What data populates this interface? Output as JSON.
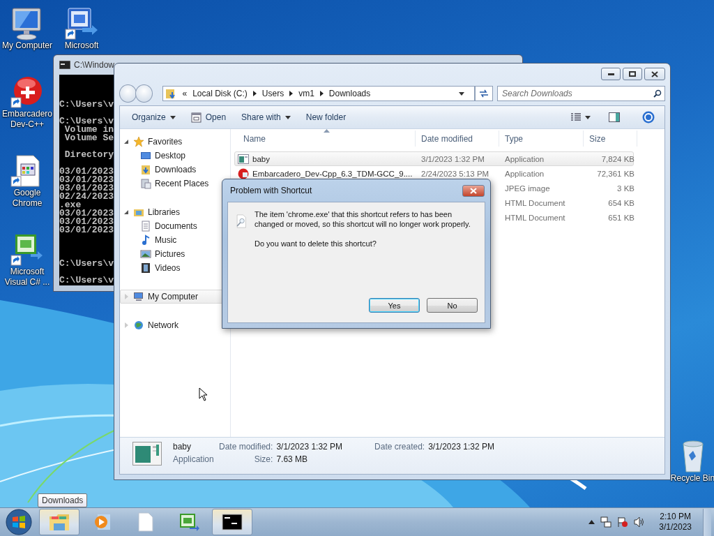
{
  "desktop": {
    "left_column": [
      {
        "label": "My Computer",
        "kind": "computer"
      },
      {
        "label": "Embarcadero Dev-C++",
        "kind": "devcpp"
      },
      {
        "label": "Google Chrome",
        "kind": "document"
      },
      {
        "label": "Microsoft Visual C# ...",
        "kind": "csharp"
      }
    ],
    "second_column": [
      {
        "label": "Microsoft",
        "kind": "vb"
      }
    ],
    "right_column": [
      {
        "label": "Recycle Bin",
        "kind": "recycle"
      }
    ]
  },
  "console_window": {
    "title": "C:\\Window",
    "lines": [
      {
        "kind": "blank"
      },
      {
        "kind": "blank"
      },
      {
        "kind": "blank"
      },
      {
        "kind": "text",
        "text": "C:\\Users\\v"
      },
      {
        "kind": "blank"
      },
      {
        "kind": "text",
        "text": "C:\\Users\\v"
      },
      {
        "kind": "text",
        "text": " Volume in"
      },
      {
        "kind": "text",
        "text": " Volume Se"
      },
      {
        "kind": "blank"
      },
      {
        "kind": "text",
        "text": " Directory"
      },
      {
        "kind": "blank"
      },
      {
        "kind": "text",
        "text": "03/01/2023"
      },
      {
        "kind": "text",
        "text": "03/01/2023"
      },
      {
        "kind": "text",
        "text": "03/01/2023"
      },
      {
        "kind": "text",
        "text": "02/24/2023"
      },
      {
        "kind": "text",
        "text": ".exe"
      },
      {
        "kind": "text",
        "text": "03/01/2023"
      },
      {
        "kind": "text",
        "text": "03/01/2023"
      },
      {
        "kind": "text",
        "text": "03/01/2023"
      },
      {
        "kind": "blank"
      },
      {
        "kind": "blank"
      },
      {
        "kind": "blank"
      },
      {
        "kind": "text",
        "text": "C:\\Users\\v"
      },
      {
        "kind": "blank"
      },
      {
        "kind": "text",
        "text": "C:\\Users\\v"
      }
    ]
  },
  "explorer": {
    "address": {
      "overflow_mark": "«",
      "path": [
        "Local Disk (C:)",
        "Users",
        "vm1",
        "Downloads"
      ]
    },
    "search": {
      "placeholder": "Search Downloads"
    },
    "toolbar": [
      {
        "label": "Organize",
        "kind": "menu"
      },
      {
        "label": "Open",
        "kind": "icon_command"
      },
      {
        "label": "Share with",
        "kind": "menu"
      },
      {
        "label": "New folder",
        "kind": "command"
      }
    ],
    "nav": [
      {
        "label": "Favorites",
        "kind": "favorites",
        "expanded": true,
        "selected": false,
        "children": [
          {
            "label": "Desktop",
            "kind": "desktop",
            "selected": false
          },
          {
            "label": "Downloads",
            "kind": "downloads",
            "selected": false
          },
          {
            "label": "Recent Places",
            "kind": "recent",
            "selected": false
          }
        ]
      },
      {
        "label": "Libraries",
        "kind": "libraries",
        "expanded": true,
        "selected": false,
        "children": [
          {
            "label": "Documents",
            "kind": "documents",
            "selected": false
          },
          {
            "label": "Music",
            "kind": "music",
            "selected": false
          },
          {
            "label": "Pictures",
            "kind": "pictures",
            "selected": false
          },
          {
            "label": "Videos",
            "kind": "videos",
            "selected": false
          }
        ]
      },
      {
        "label": "My Computer",
        "kind": "computer",
        "expanded": false,
        "selected": true
      },
      {
        "label": "Network",
        "kind": "network",
        "expanded": false,
        "selected": false
      }
    ],
    "columns": [
      {
        "label": "Name",
        "sorted": true
      },
      {
        "label": "Date modified",
        "sorted": false
      },
      {
        "label": "Type",
        "sorted": false
      },
      {
        "label": "Size",
        "sorted": false
      }
    ],
    "rows": [
      {
        "name": "baby",
        "date": "3/1/2023 1:32 PM",
        "type": "Application",
        "size": "7,824 KB",
        "kind": "app",
        "selected": true
      },
      {
        "name": "Embarcadero_Dev-Cpp_6.3_TDM-GCC_9....",
        "date": "2/24/2023 5:13 PM",
        "type": "Application",
        "size": "72,361 KB",
        "kind": "devcpp",
        "selected": false
      },
      {
        "type": "JPEG image",
        "size": "3 KB",
        "selected": false
      },
      {
        "type": "HTML Document",
        "size": "654 KB",
        "selected": false
      },
      {
        "type": "HTML Document",
        "size": "651 KB",
        "selected": false
      }
    ],
    "details": {
      "name": "baby",
      "type": "Application",
      "field_columns": [
        [
          {
            "label": "Date modified:",
            "value": "3/1/2023 1:32 PM"
          },
          {
            "label": "Size:",
            "value": "7.63 MB"
          }
        ],
        [
          {
            "label": "Date created:",
            "value": "3/1/2023 1:32 PM"
          }
        ]
      ]
    }
  },
  "dialog": {
    "title": "Problem with Shortcut",
    "message": "The item 'chrome.exe' that this shortcut refers to has been changed or moved, so this shortcut will no longer work properly.",
    "question": "Do you want to delete this shortcut?",
    "buttons": [
      {
        "label": "Yes",
        "default": true
      },
      {
        "label": "No",
        "default": false
      }
    ]
  },
  "taskbar": {
    "items": [
      {
        "kind": "explorer",
        "active": true
      },
      {
        "kind": "media",
        "active": false
      },
      {
        "kind": "document",
        "active": false
      },
      {
        "kind": "csharp",
        "active": false
      },
      {
        "kind": "console",
        "active": true
      }
    ],
    "tooltip": "Downloads",
    "clock": {
      "time": "2:10 PM",
      "date": "3/1/2023"
    }
  }
}
